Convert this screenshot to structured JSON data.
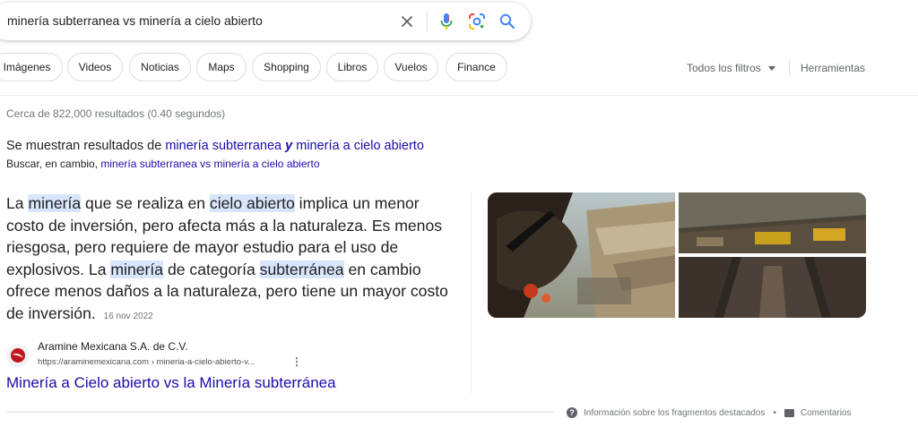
{
  "search": {
    "query": "minería subterranea vs minería a cielo abierto"
  },
  "icons": {
    "clear": "close-icon",
    "voice": "microphone-icon",
    "lens": "google-lens-icon",
    "search": "search-icon"
  },
  "chips": [
    "Imágenes",
    "Videos",
    "Noticias",
    "Maps",
    "Shopping",
    "Libros",
    "Vuelos",
    "Finance"
  ],
  "tools": {
    "filters_label": "Todos los filtros",
    "tools_label": "Herramientas"
  },
  "results": {
    "stats": "Cerca de 822,000 resultados (0.40 segundos)",
    "showing_prefix": "Se muestran resultados de ",
    "showing_term1": "minería subterranea",
    "showing_and": "y",
    "showing_term2": "minería a cielo abierto",
    "instead_prefix": "Buscar, en cambio, ",
    "instead_link": "minería subterranea vs minería a cielo abierto"
  },
  "featured": {
    "snippet_parts": [
      "La ",
      "minería",
      " que se realiza en ",
      "cielo abierto",
      " implica un menor costo de inversión, pero afecta más a la naturaleza. Es menos riesgosa, pero requiere de mayor estudio para el uso de explosivos. La ",
      "minería",
      " de categoría ",
      "subterránea",
      " en cambio ofrece menos daños a la naturaleza, pero tiene un mayor costo de inversión."
    ],
    "date": "16 nov 2022",
    "source_name": "Aramine Mexicana S.A. de C.V.",
    "source_url": "https://araminemexicana.com › mineria-a-cielo-abierto-v...",
    "title": "Minería a Cielo abierto vs la Minería subterránea"
  },
  "footer": {
    "about_label": "Información sobre los fragmentos destacados",
    "separator": "•",
    "feedback_label": "Comentarios"
  },
  "colors": {
    "link": "#1a0dab",
    "highlight": "#d8e6fb",
    "mic_blue": "#4285f4",
    "mic_red": "#ea4335"
  }
}
